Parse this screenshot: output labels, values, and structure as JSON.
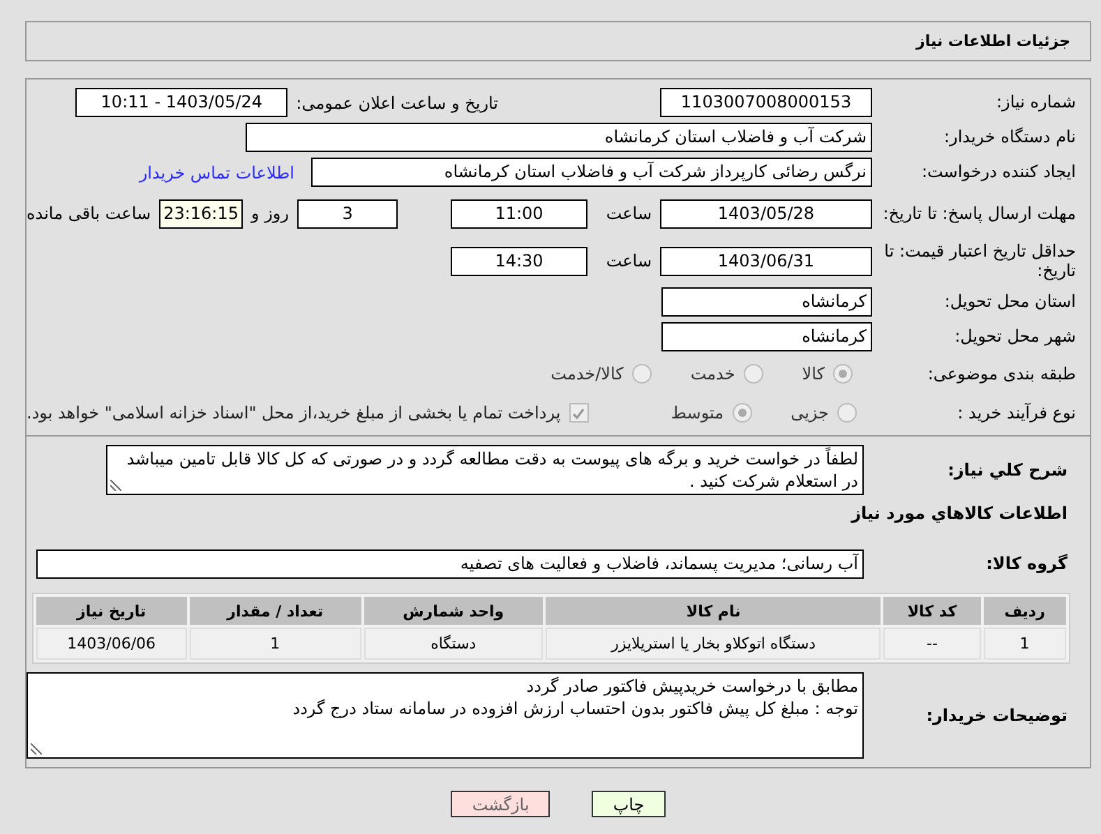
{
  "header": {
    "title": "جزئیات اطلاعات نیاز"
  },
  "need_number": {
    "label": "شماره نیاز:",
    "value": "1103007008000153"
  },
  "announce": {
    "label": "تاریخ و ساعت اعلان عمومی:",
    "value": "1403/05/24 - 10:11"
  },
  "buyer_org": {
    "label": "نام دستگاه خریدار:",
    "value": "شرکت آب و فاضلاب استان کرمانشاه"
  },
  "creator": {
    "label": "ایجاد کننده درخواست:",
    "value": "نرگس رضائی کارپرداز شرکت آب و فاضلاب استان کرمانشاه",
    "link": "اطلاعات تماس خریدار"
  },
  "deadline": {
    "label": "مهلت ارسال پاسخ: تا تاریخ:",
    "date": "1403/05/28",
    "time_label": "ساعت",
    "time": "11:00",
    "days": "3",
    "days_label": "روز و",
    "remaining": "23:16:15",
    "remaining_label": "ساعت باقی مانده"
  },
  "validity": {
    "label": "حداقل تاریخ اعتبار قیمت: تا تاریخ:",
    "date": "1403/06/31",
    "time_label": "ساعت",
    "time": "14:30"
  },
  "province": {
    "label": "استان محل تحویل:",
    "value": "کرمانشاه"
  },
  "city": {
    "label": "شهر محل تحویل:",
    "value": "کرمانشاه"
  },
  "category": {
    "label": "طبقه بندی موضوعی:",
    "options": [
      {
        "label": "کالا",
        "selected": true
      },
      {
        "label": "خدمت",
        "selected": false
      },
      {
        "label": "کالا/خدمت",
        "selected": false
      }
    ]
  },
  "process": {
    "label": "نوع فرآیند خرید :",
    "options": [
      {
        "label": "جزیی",
        "selected": false
      },
      {
        "label": "متوسط",
        "selected": true
      }
    ],
    "payment": {
      "checked": true,
      "text": "پرداخت تمام یا بخشی از مبلغ خرید،از محل \"اسناد خزانه اسلامی\" خواهد بود."
    }
  },
  "description": {
    "label": "شرح کلي نياز:",
    "value": "لطفاً در خواست خرید و برگه های پیوست به دقت مطالعه گردد و در صورتی که کل کالا قابل تامین میباشد در استعلام شرکت کنید ."
  },
  "goods_heading": "اطلاعات کالاهاي مورد نياز",
  "goods_group": {
    "label": "گروه کالا:",
    "value": "آب رسانی؛ مدیریت پسماند، فاضلاب و فعالیت های تصفیه"
  },
  "table": {
    "columns": [
      "ردیف",
      "کد کالا",
      "نام کالا",
      "واحد شمارش",
      "تعداد / مقدار",
      "تاریخ نیاز"
    ],
    "rows": [
      [
        "1",
        "--",
        "دستگاه اتوکلاو بخار یا استریلایزر",
        "دستگاه",
        "1",
        "1403/06/06"
      ]
    ]
  },
  "buyer_notes": {
    "label": "توضیحات خریدار:",
    "lines": [
      "مطابق با درخواست خریدپیش فاکتور صادر گردد",
      "توجه : مبلغ کل پیش فاکتور بدون احتساب ارزش افزوده در سامانه ستاد درج گردد"
    ]
  },
  "buttons": [
    {
      "label": "چاپ",
      "kind": "print"
    },
    {
      "label": "بازگشت",
      "kind": "back"
    }
  ]
}
